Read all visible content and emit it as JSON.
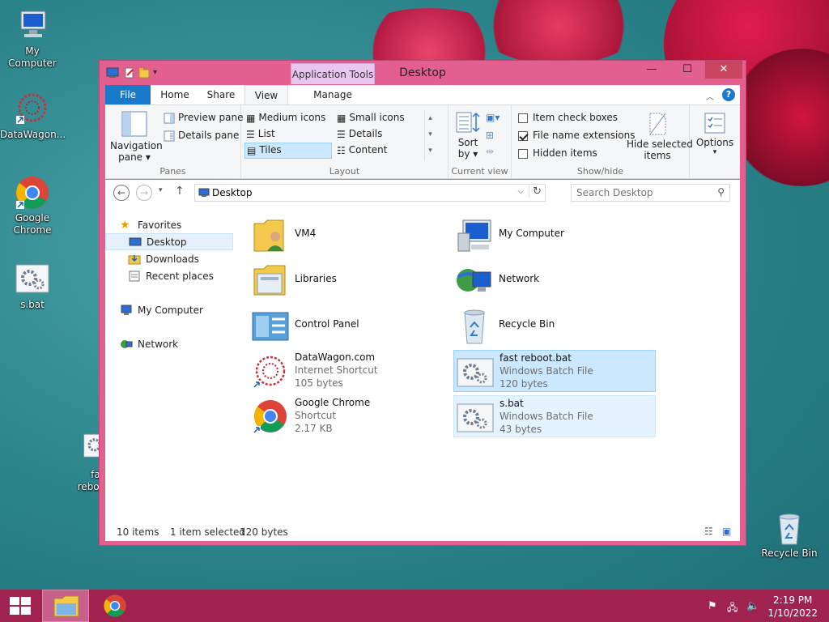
{
  "desktop": {
    "icons": [
      {
        "label": "My Computer"
      },
      {
        "label": "DataWagon..."
      },
      {
        "label": "Google\nChrome"
      },
      {
        "label": "s.bat"
      },
      {
        "label": "Recycle Bin"
      }
    ],
    "partial_icon": {
      "label_line1": "fas",
      "label_line2": "reboo"
    }
  },
  "window": {
    "title": "Desktop",
    "contextual_tab": "Application Tools",
    "tabs": [
      "File",
      "Home",
      "Share",
      "View",
      "Manage"
    ],
    "ribbon": {
      "panes_group": {
        "label": "Panes",
        "navigation_pane_line1": "Navigation",
        "navigation_pane_line2": "pane",
        "preview_pane": "Preview pane",
        "details_pane": "Details pane"
      },
      "layout_group": {
        "label": "Layout",
        "items": [
          "Medium icons",
          "Small icons",
          "List",
          "Details",
          "Tiles",
          "Content"
        ],
        "selected": "Tiles"
      },
      "current_view_group": {
        "label": "Current view",
        "sort_line1": "Sort",
        "sort_line2": "by"
      },
      "show_hide_group": {
        "label": "Show/hide",
        "item_check_boxes": "Item check boxes",
        "file_name_extensions": "File name extensions",
        "hidden_items": "Hidden items",
        "item_check_boxes_checked": false,
        "file_name_extensions_checked": true,
        "hidden_items_checked": false,
        "hide_selected_line1": "Hide selected",
        "hide_selected_line2": "items"
      },
      "options_label": "Options"
    },
    "address": {
      "path": "Desktop",
      "search_placeholder": "Search Desktop"
    },
    "nav_pane": {
      "favorites": "Favorites",
      "desktop": "Desktop",
      "downloads": "Downloads",
      "recent_places": "Recent places",
      "my_computer": "My Computer",
      "network": "Network"
    },
    "items": [
      {
        "name": "VM4"
      },
      {
        "name": "My Computer"
      },
      {
        "name": "Libraries"
      },
      {
        "name": "Network"
      },
      {
        "name": "Control Panel"
      },
      {
        "name": "Recycle Bin"
      },
      {
        "name": "DataWagon.com",
        "type": "Internet Shortcut",
        "size": "105 bytes"
      },
      {
        "name": "fast reboot.bat",
        "type": "Windows Batch File",
        "size": "120 bytes"
      },
      {
        "name": "Google Chrome",
        "type": "Shortcut",
        "size": "2.17 KB"
      },
      {
        "name": "s.bat",
        "type": "Windows Batch File",
        "size": "43 bytes"
      }
    ],
    "status": {
      "count": "10 items",
      "selection": "1 item selected",
      "size": "120 bytes"
    }
  },
  "taskbar": {
    "time": "2:19 PM",
    "date": "1/10/2022"
  },
  "colors": {
    "window_frame": "#e35f8f",
    "taskbar": "#a0234f",
    "file_tab": "#1979ca",
    "selection": "#cce8ff"
  }
}
